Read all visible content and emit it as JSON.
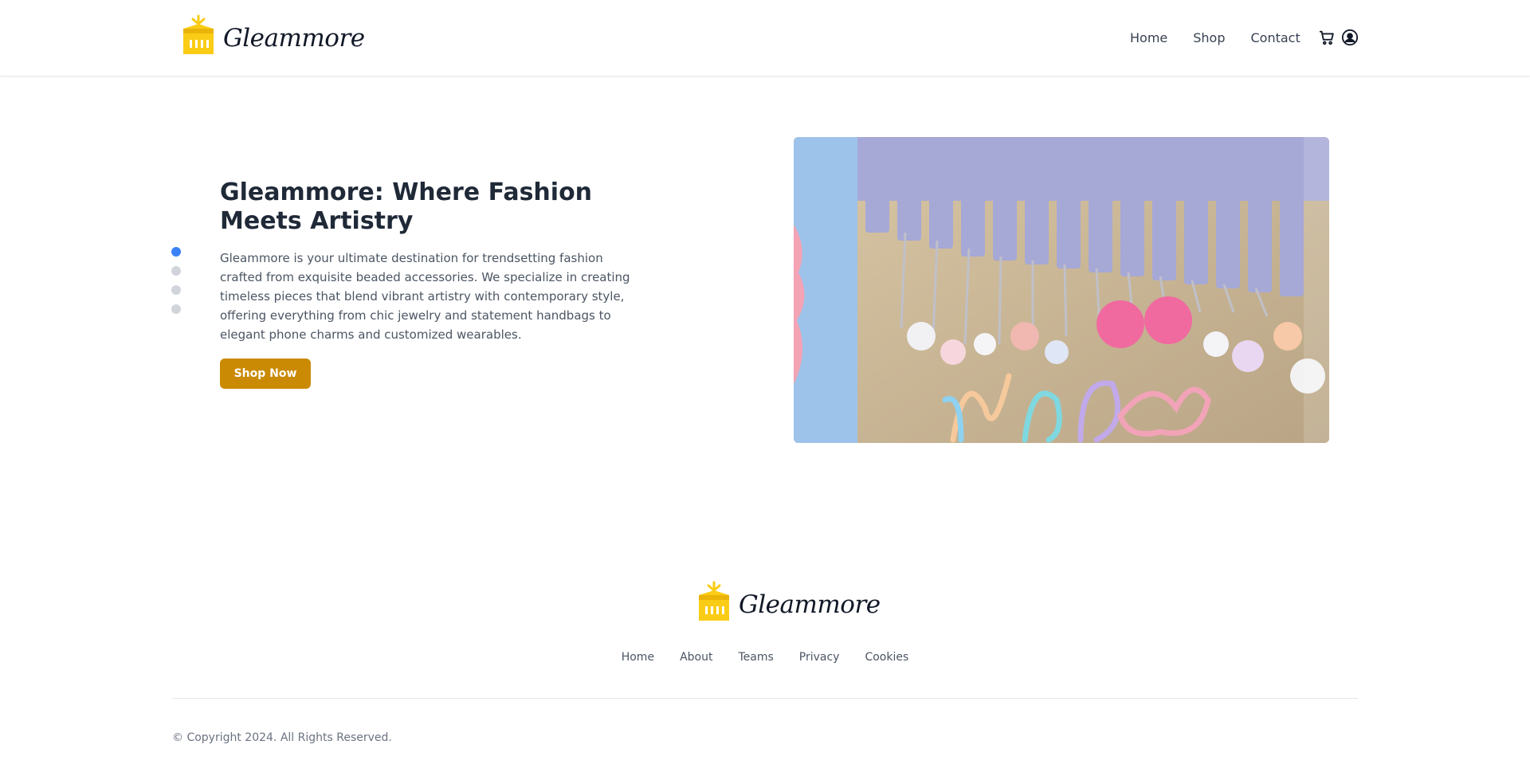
{
  "brand": {
    "name": "Gleammore",
    "logo_color": "#facc15"
  },
  "header": {
    "nav": [
      "Home",
      "Shop",
      "Contact"
    ],
    "icons": [
      "cart-icon",
      "user-icon"
    ]
  },
  "hero": {
    "title": "Gleammore: Where Fashion Meets Artistry",
    "description": "Gleammore is your ultimate destination for trendsetting fashion crafted from exquisite beaded accessories. We specialize in creating timeless pieces that blend vibrant artistry with contemporary style, offering everything from chic jewelry and statement handbags to elegant phone charms and customized wearables.",
    "button_label": "Shop Now",
    "button_color": "#ca8a04",
    "carousel_active_index": 0,
    "carousel_count": 4,
    "carousel_active_color": "#3b82f6"
  },
  "footer": {
    "links": [
      "Home",
      "About",
      "Teams",
      "Privacy",
      "Cookies"
    ],
    "copyright": "© Copyright 2024. All Rights Reserved."
  }
}
